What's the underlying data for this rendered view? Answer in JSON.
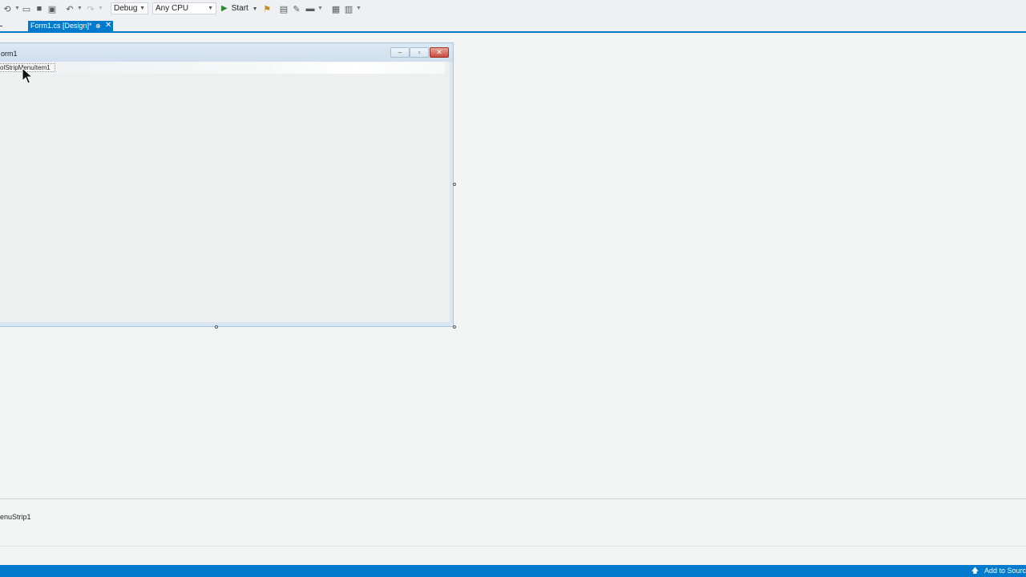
{
  "toolbar": {
    "config_value": "Debug",
    "platform_value": "Any CPU",
    "start_label": "Start"
  },
  "tab": {
    "title": "Form1.cs [Design]*",
    "pin_icon": "pin-icon",
    "close_glyph": "✕"
  },
  "form": {
    "title": "orm1",
    "menu_item_label": "olStripMenuItem1"
  },
  "tray": {
    "component_label": "enuStrip1"
  },
  "status": {
    "source_control_label": "Add to Sourc"
  },
  "colors": {
    "accent": "#007acc",
    "canvas": "#f3f4f4"
  }
}
